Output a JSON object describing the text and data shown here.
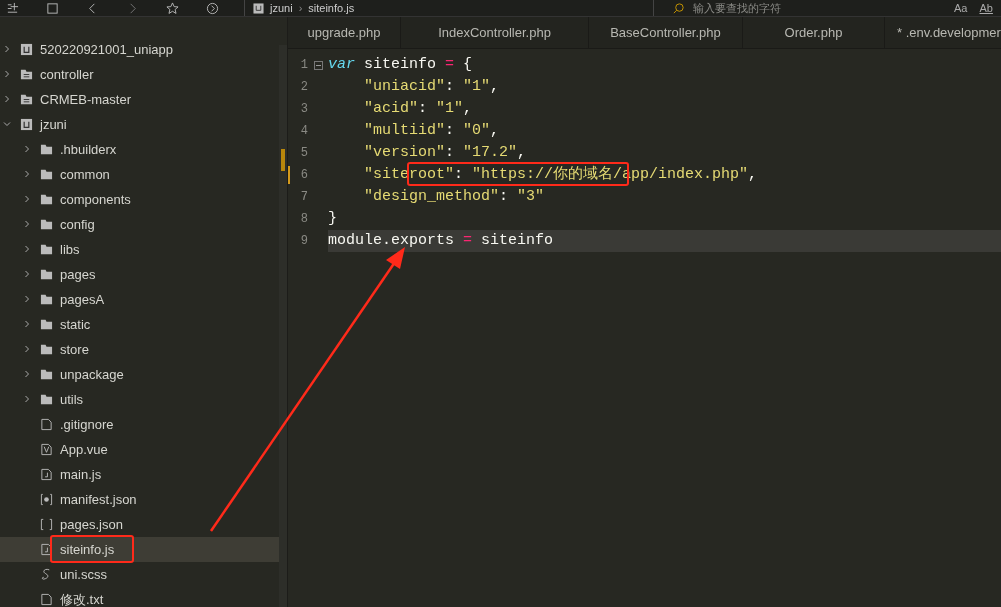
{
  "toolbar": {
    "breadcrumb": [
      "jzuni",
      "siteinfo.js"
    ],
    "separator": "›",
    "search": {
      "placeholder": "输入要查找的字符"
    },
    "match_case": "Aa",
    "whole_word": "Ab"
  },
  "tree": [
    {
      "label": "520220921001_uniapp",
      "kind": "project",
      "expanded": false,
      "selected": false,
      "annotated": false
    },
    {
      "label": "controller",
      "kind": "folder-doc",
      "expanded": false,
      "selected": false,
      "annotated": false
    },
    {
      "label": "CRMEB-master",
      "kind": "folder-doc",
      "expanded": false,
      "selected": false,
      "annotated": false
    },
    {
      "label": "jzuni",
      "kind": "project",
      "expanded": true,
      "selected": false,
      "annotated": false,
      "children": [
        {
          "label": ".hbuilderx",
          "kind": "folder",
          "expanded": false,
          "selected": false,
          "annotated": false
        },
        {
          "label": "common",
          "kind": "folder",
          "expanded": false,
          "selected": false,
          "annotated": false
        },
        {
          "label": "components",
          "kind": "folder",
          "expanded": false,
          "selected": false,
          "annotated": false
        },
        {
          "label": "config",
          "kind": "folder",
          "expanded": false,
          "selected": false,
          "annotated": false
        },
        {
          "label": "libs",
          "kind": "folder",
          "expanded": false,
          "selected": false,
          "annotated": false
        },
        {
          "label": "pages",
          "kind": "folder",
          "expanded": false,
          "selected": false,
          "annotated": false
        },
        {
          "label": "pagesA",
          "kind": "folder",
          "expanded": false,
          "selected": false,
          "annotated": false
        },
        {
          "label": "static",
          "kind": "folder",
          "expanded": false,
          "selected": false,
          "annotated": false
        },
        {
          "label": "store",
          "kind": "folder",
          "expanded": false,
          "selected": false,
          "annotated": false
        },
        {
          "label": "unpackage",
          "kind": "folder",
          "expanded": false,
          "selected": false,
          "annotated": false
        },
        {
          "label": "utils",
          "kind": "folder",
          "expanded": false,
          "selected": false,
          "annotated": false
        },
        {
          "label": ".gitignore",
          "kind": "file",
          "selected": false,
          "annotated": false
        },
        {
          "label": "App.vue",
          "kind": "vue",
          "selected": false,
          "annotated": false
        },
        {
          "label": "main.js",
          "kind": "js",
          "selected": false,
          "annotated": false
        },
        {
          "label": "manifest.json",
          "kind": "settings",
          "selected": false,
          "annotated": false
        },
        {
          "label": "pages.json",
          "kind": "json",
          "selected": false,
          "annotated": false
        },
        {
          "label": "siteinfo.js",
          "kind": "js",
          "selected": true,
          "annotated": true
        },
        {
          "label": "uni.scss",
          "kind": "scss",
          "selected": false,
          "annotated": false
        },
        {
          "label": "修改.txt",
          "kind": "file",
          "selected": false,
          "annotated": false
        }
      ]
    }
  ],
  "tabs": [
    {
      "label": "upgrade.php",
      "selected": false
    },
    {
      "label": "IndexController.php",
      "selected": false
    },
    {
      "label": "BaseController.php",
      "selected": false
    },
    {
      "label": "Order.php",
      "selected": false
    },
    {
      "label": "* .env.developmer",
      "selected": false
    }
  ],
  "code": [
    {
      "number": "1",
      "foldable": true,
      "indent": false,
      "highlighted": false,
      "modified": false,
      "annotated": false,
      "tokens": [
        {
          "kind": "keyword",
          "text": "var"
        },
        {
          "kind": "plain",
          "text": " siteinfo "
        },
        {
          "kind": "op",
          "text": "="
        },
        {
          "kind": "plain",
          "text": " {"
        }
      ]
    },
    {
      "number": "2",
      "foldable": false,
      "indent": true,
      "highlighted": false,
      "modified": false,
      "annotated": false,
      "tokens": [
        {
          "kind": "string",
          "text": "\"uniacid\""
        },
        {
          "kind": "plain",
          "text": ": "
        },
        {
          "kind": "string",
          "text": "\"1\""
        },
        {
          "kind": "plain",
          "text": ","
        }
      ]
    },
    {
      "number": "3",
      "foldable": false,
      "indent": true,
      "highlighted": false,
      "modified": false,
      "annotated": false,
      "tokens": [
        {
          "kind": "string",
          "text": "\"acid\""
        },
        {
          "kind": "plain",
          "text": ": "
        },
        {
          "kind": "string",
          "text": "\"1\""
        },
        {
          "kind": "plain",
          "text": ","
        }
      ]
    },
    {
      "number": "4",
      "foldable": false,
      "indent": true,
      "highlighted": false,
      "modified": false,
      "annotated": false,
      "tokens": [
        {
          "kind": "string",
          "text": "\"multiid\""
        },
        {
          "kind": "plain",
          "text": ": "
        },
        {
          "kind": "string",
          "text": "\"0\""
        },
        {
          "kind": "plain",
          "text": ","
        }
      ]
    },
    {
      "number": "5",
      "foldable": false,
      "indent": true,
      "highlighted": false,
      "modified": false,
      "annotated": false,
      "tokens": [
        {
          "kind": "string",
          "text": "\"version\""
        },
        {
          "kind": "plain",
          "text": ": "
        },
        {
          "kind": "string",
          "text": "\"17.2\""
        },
        {
          "kind": "plain",
          "text": ","
        }
      ]
    },
    {
      "number": "6",
      "foldable": false,
      "indent": true,
      "highlighted": false,
      "modified": true,
      "annotated": true,
      "tokens": [
        {
          "kind": "string",
          "text": "\"siteroot\""
        },
        {
          "kind": "plain",
          "text": ": "
        },
        {
          "kind": "string",
          "text": "\"https://你的域名/app/index.php\""
        },
        {
          "kind": "plain",
          "text": ","
        }
      ]
    },
    {
      "number": "7",
      "foldable": false,
      "indent": true,
      "highlighted": false,
      "modified": false,
      "annotated": false,
      "tokens": [
        {
          "kind": "string",
          "text": "\"design_method\""
        },
        {
          "kind": "plain",
          "text": ": "
        },
        {
          "kind": "string",
          "text": "\"3\""
        }
      ]
    },
    {
      "number": "8",
      "foldable": false,
      "indent": false,
      "highlighted": false,
      "modified": false,
      "annotated": false,
      "tokens": [
        {
          "kind": "plain",
          "text": "}"
        }
      ]
    },
    {
      "number": "9",
      "foldable": false,
      "indent": false,
      "highlighted": true,
      "modified": false,
      "annotated": false,
      "tokens": [
        {
          "kind": "plain",
          "text": "module.exports "
        },
        {
          "kind": "op",
          "text": "="
        },
        {
          "kind": "plain",
          "text": " siteinfo"
        }
      ]
    }
  ],
  "annotation_arrow": true
}
